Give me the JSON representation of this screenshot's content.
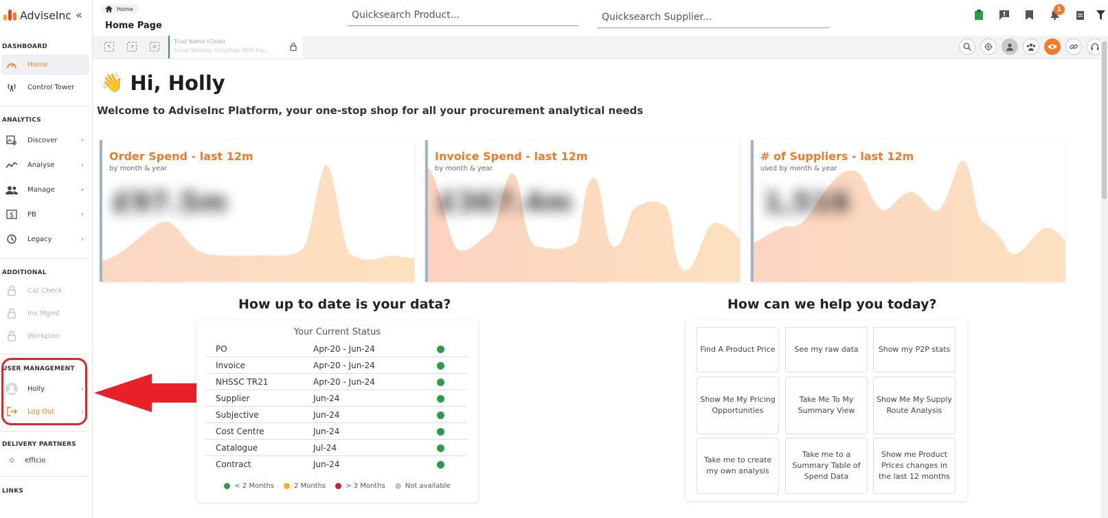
{
  "sidebar": {
    "brand": "AdviseInc",
    "collapse_glyph": "«",
    "sections": {
      "dashboard": "DASHBOARD",
      "analytics": "ANALYTICS",
      "additional": "ADDITIONAL",
      "user_management": "USER MANAGEMENT",
      "delivery_partners": "DELIVERY PARTNERS",
      "links": "LINKS"
    },
    "items": {
      "home": "Home",
      "control_tower": "Control Tower",
      "discover": "Discover",
      "analyse": "Analyse",
      "manage": "Manage",
      "pb": "PB",
      "legacy": "Legacy",
      "cat_check": "Cat Check",
      "inv_mgmt": "Inv Mgmt",
      "workplan": "Workplan",
      "holly": "Holly",
      "log_out": "Log Out",
      "efficio": "efficio"
    },
    "chevron": "›"
  },
  "header": {
    "breadcrumb": "Home",
    "page_title": "Home Page",
    "search_product_placeholder": "Quicksearch Product...",
    "search_supplier_placeholder": "Quicksearch Supplier...",
    "notification_count": "1"
  },
  "subbar": {
    "trust_label": "Trust Name (Code)",
    "trust_value": "Great Western Hospitals NHS Fou..."
  },
  "main": {
    "greeting": "Hi, Holly",
    "wave": "👋",
    "welcome": "Welcome to AdviseInc Platform, your one-stop shop for all your procurement analytical needs",
    "cards": [
      {
        "title": "Order Spend - last 12m",
        "subtitle": "by month & year",
        "value": "£97.5m"
      },
      {
        "title": "Invoice Spend - last 12m",
        "subtitle": "by month & year",
        "value": "£367.4m"
      },
      {
        "title": "# of Suppliers - last 12m",
        "subtitle": "used by month & year",
        "value": "1,516"
      }
    ],
    "data_heading": "How up to date is your data?",
    "help_heading": "How can we help you today?",
    "status": {
      "title": "Your Current Status",
      "rows": [
        {
          "name": "PO",
          "period": "Apr-20 - Jun-24",
          "color": "#2e9b4a"
        },
        {
          "name": "Invoice",
          "period": "Apr-20 - Jun-24",
          "color": "#2e9b4a"
        },
        {
          "name": "NHSSC TR21",
          "period": "Apr-20 - Jun-24",
          "color": "#2e9b4a"
        },
        {
          "name": "Supplier",
          "period": "Jun-24",
          "color": "#2e9b4a"
        },
        {
          "name": "Subjective",
          "period": "Jun-24",
          "color": "#2e9b4a"
        },
        {
          "name": "Cost Centre",
          "period": "Jun-24",
          "color": "#2e9b4a"
        },
        {
          "name": "Catalogue",
          "period": "Jul-24",
          "color": "#2e9b4a"
        },
        {
          "name": "Contract",
          "period": "Jun-24",
          "color": "#2e9b4a"
        }
      ],
      "legend": [
        {
          "label": "< 2 Months",
          "color": "#2e9b4a"
        },
        {
          "label": "2 Months",
          "color": "#f5b40a"
        },
        {
          "label": "> 3 Months",
          "color": "#c8232c"
        },
        {
          "label": "Not available",
          "color": "#c4c4c4"
        }
      ]
    },
    "help_tiles": [
      "Find A Product Price",
      "See my raw data",
      "Show my P2P stats",
      "Show Me My Pricing Opportunities",
      "Take Me To My Summary View",
      "Show Me My Supply Route Analysis",
      "Take me to create my own analysis",
      "Take me to a Summary Table of Spend Data",
      "Show me Product Prices changes in the last 12 months"
    ]
  },
  "colors": {
    "accent": "#f07b2c",
    "status_green": "#2e9b4a",
    "annotation_red": "#e82028"
  }
}
